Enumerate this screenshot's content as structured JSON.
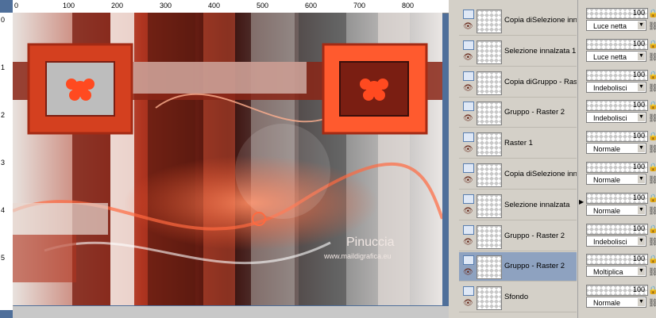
{
  "ruler": {
    "top_labels": [
      "0",
      "100",
      "200",
      "300",
      "400",
      "500",
      "600",
      "700",
      "800"
    ],
    "left_labels": [
      "0",
      "1",
      "2",
      "3",
      "4",
      "5"
    ]
  },
  "artwork": {
    "watermark_title": "Pinuccia",
    "watermark_url": "www.maildigrafica.eu",
    "colors": {
      "accent": "#ff5a2e",
      "dark": "#6b1d12",
      "light": "#f4ece8"
    }
  },
  "layers": [
    {
      "name": "Copia diSelezione inna",
      "opacity": "100",
      "blend": "Luce netta",
      "selected": false
    },
    {
      "name": "Selezione innalzata 1",
      "opacity": "100",
      "blend": "Luce netta",
      "selected": false
    },
    {
      "name": "Copia diGruppo - Rast",
      "opacity": "100",
      "blend": "Indebolisci",
      "selected": false
    },
    {
      "name": "Gruppo - Raster 2",
      "opacity": "100",
      "blend": "Indebolisci",
      "selected": false
    },
    {
      "name": "Raster 1",
      "opacity": "100",
      "blend": "Normale",
      "selected": false
    },
    {
      "name": "Copia diSelezione inna",
      "opacity": "100",
      "blend": "Normale",
      "selected": false
    },
    {
      "name": "Selezione innalzata",
      "opacity": "100",
      "blend": "Normale",
      "selected": false
    },
    {
      "name": "Gruppo - Raster 2",
      "opacity": "100",
      "blend": "Indebolisci",
      "selected": false
    },
    {
      "name": "Gruppo - Raster 2",
      "opacity": "100",
      "blend": "Moltiplica",
      "selected": true
    },
    {
      "name": "Sfondo",
      "opacity": "100",
      "blend": "Normale",
      "selected": false
    }
  ],
  "icons": {
    "eye": "eye-icon",
    "lock": "lock-icon",
    "link": "link-icon",
    "dropdown": "chevron-down-icon"
  }
}
